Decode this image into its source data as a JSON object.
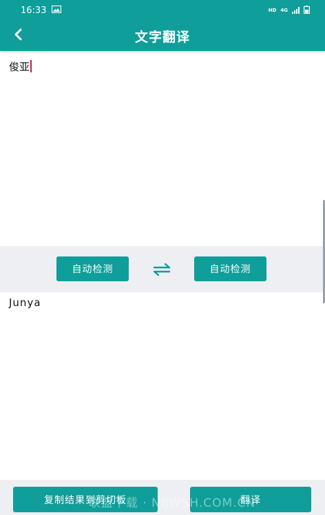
{
  "status_bar": {
    "time": "16:33",
    "hd_label": "HD",
    "network_label": "4G"
  },
  "header": {
    "title": "文字翻译"
  },
  "input": {
    "text": "俊亚"
  },
  "controls": {
    "source_lang": "自动检测",
    "target_lang": "自动检测"
  },
  "output": {
    "text": "Junya"
  },
  "footer": {
    "copy_label": "复制结果到剪切板",
    "translate_label": "翻译",
    "watermark": "联盟下载 · NBWSH.COM.CN"
  },
  "colors": {
    "accent": "#0f9e9a",
    "panel_bg": "#eeeff3",
    "caret": "#c2185b"
  },
  "icons": {
    "back": "chevron-left-icon",
    "swap": "swap-arrows-icon",
    "image": "image-icon",
    "signal": "signal-icon",
    "battery": "battery-icon"
  }
}
